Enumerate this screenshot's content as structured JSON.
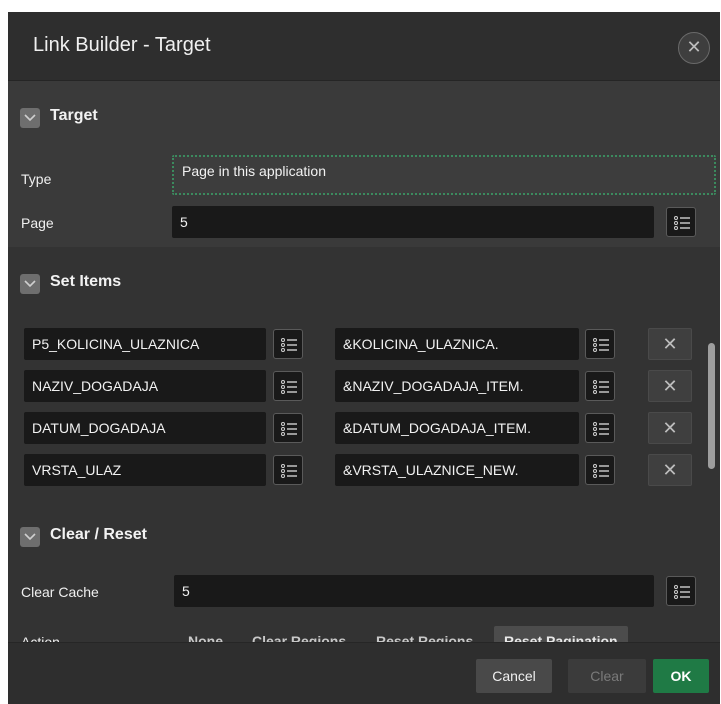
{
  "dialog": {
    "title": "Link Builder - Target",
    "close_glyph": "✕"
  },
  "target": {
    "heading": "Target",
    "type_label": "Type",
    "type_value": "Page in this application",
    "page_label": "Page",
    "page_value": "5"
  },
  "set_items": {
    "heading": "Set Items",
    "rows": [
      {
        "name": "P5_KOLICINA_ULAZNICA",
        "value": "&KOLICINA_ULAZNICA."
      },
      {
        "name": "NAZIV_DOGADAJA",
        "value": "&NAZIV_DOGADAJA_ITEM."
      },
      {
        "name": "DATUM_DOGADAJA",
        "value": "&DATUM_DOGADAJA_ITEM."
      },
      {
        "name": "VRSTA_ULAZ",
        "value": "&VRSTA_ULAZNICE_NEW."
      }
    ],
    "delete_glyph": "✕"
  },
  "clear_reset": {
    "heading": "Clear / Reset",
    "clear_cache_label": "Clear Cache",
    "clear_cache_value": "5",
    "action_label": "Action",
    "action_options": [
      "None",
      "Clear Regions",
      "Reset Regions",
      "Reset Pagination"
    ],
    "action_selected": "Reset Pagination"
  },
  "footer": {
    "cancel": "Cancel",
    "clear": "Clear",
    "ok": "OK"
  },
  "colors": {
    "dialog_bg": "#333333",
    "field_bg": "#191919",
    "ok_green": "#1f7a45",
    "focus_border": "#3b8a5e"
  },
  "icons": [
    "close-icon",
    "chevron-down-icon",
    "list-icon",
    "delete-icon"
  ]
}
